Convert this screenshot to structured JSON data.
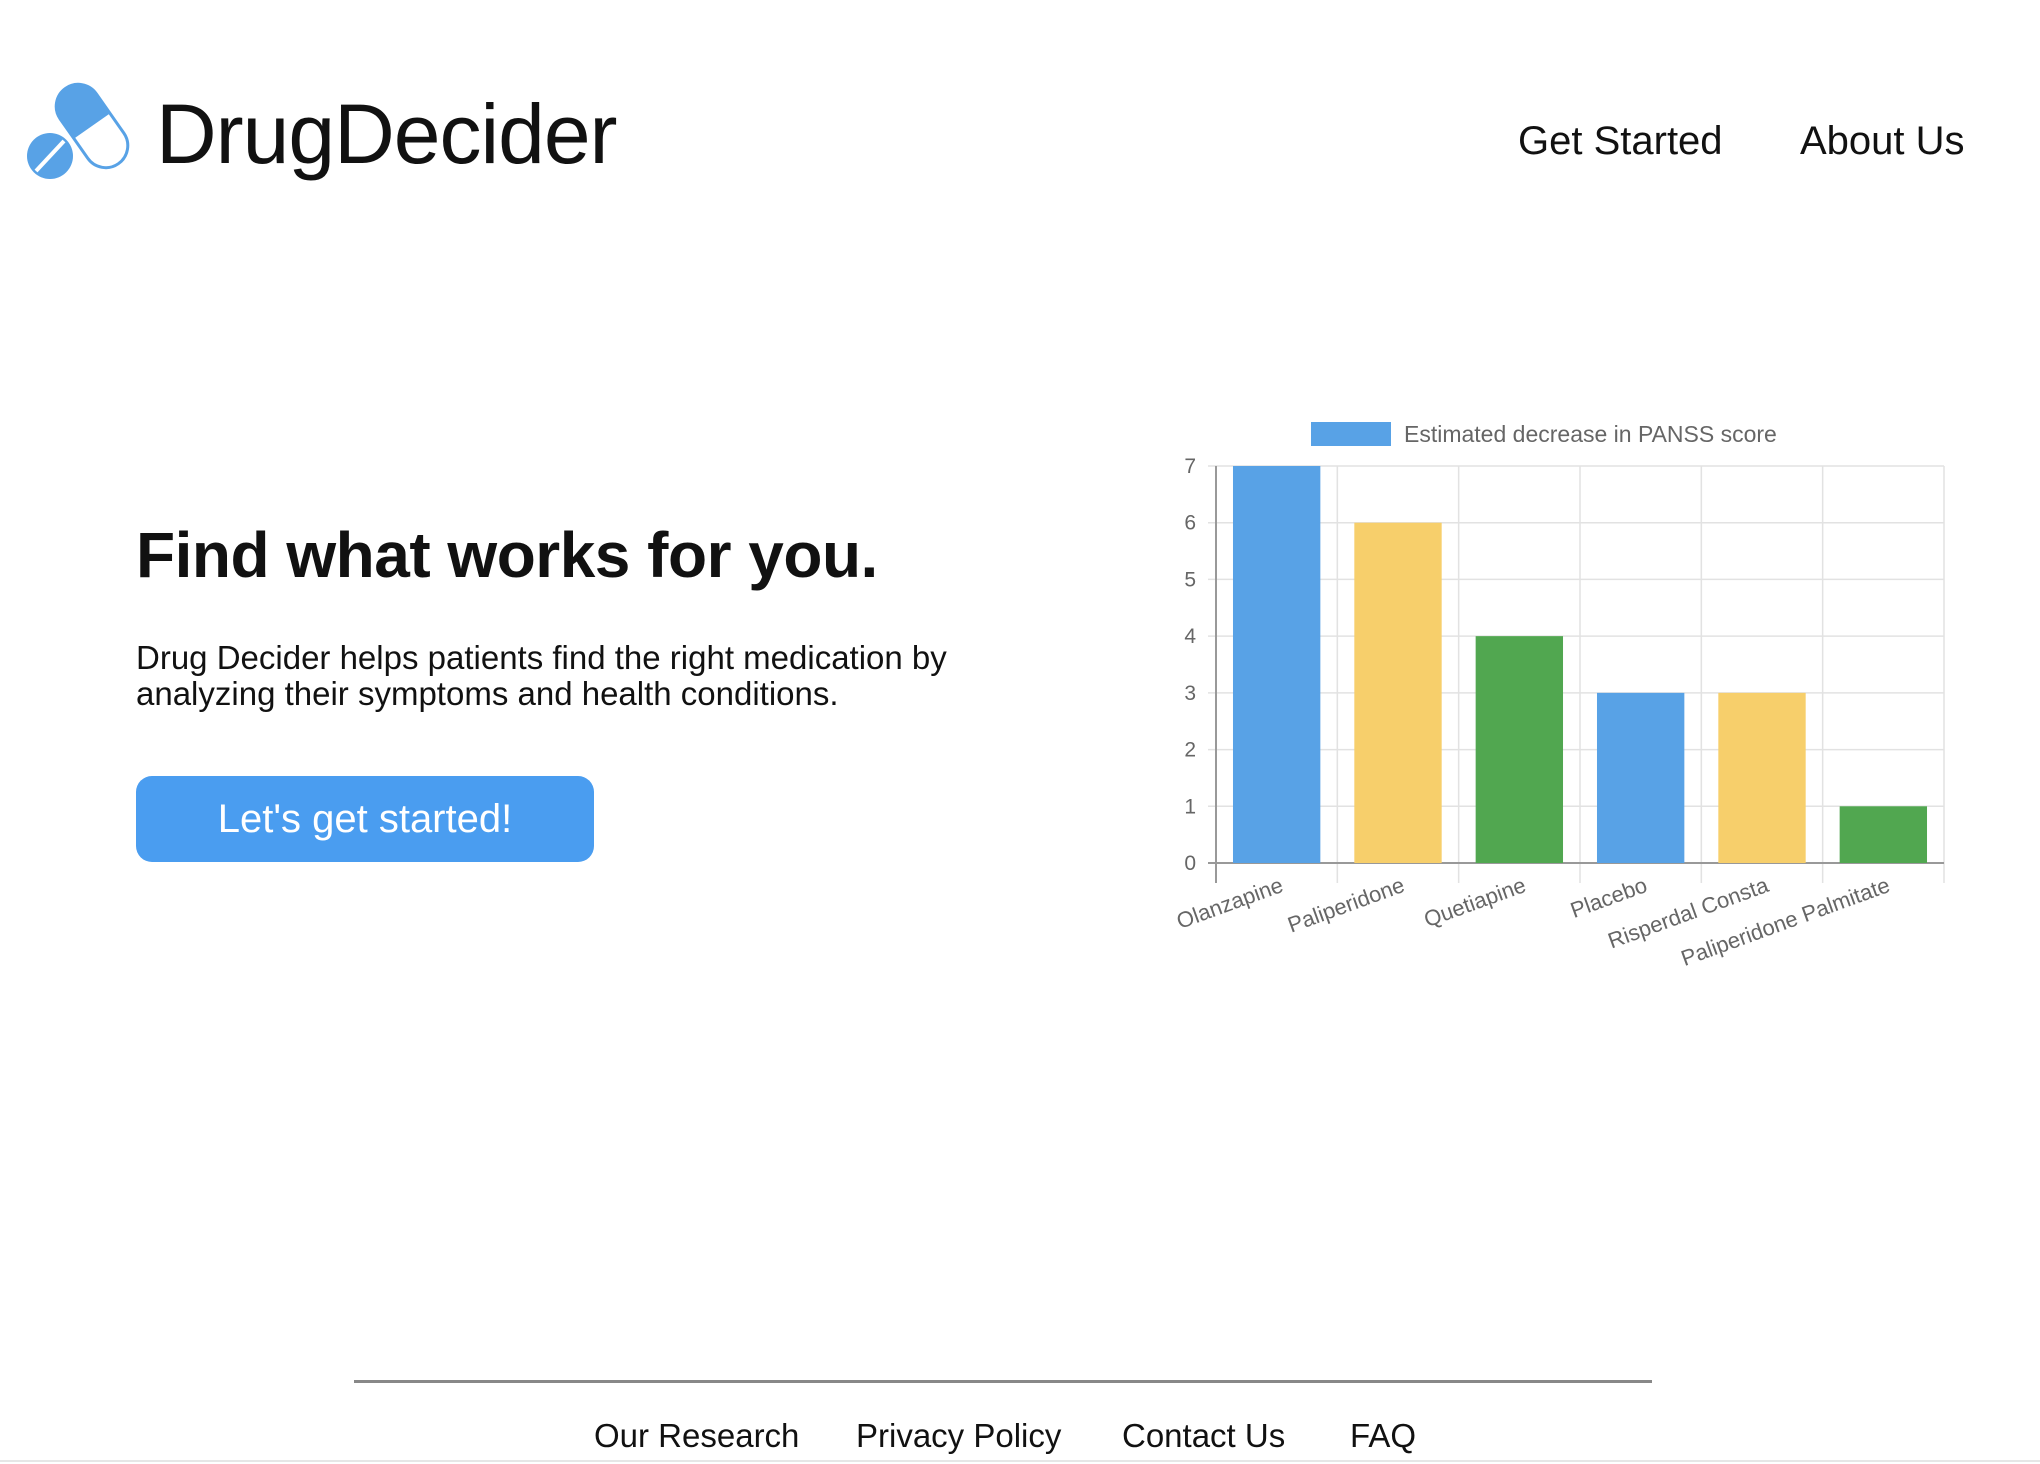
{
  "header": {
    "brand": "DrugDecider",
    "nav": [
      {
        "label": "Get Started"
      },
      {
        "label": "About Us"
      }
    ]
  },
  "hero": {
    "title": "Find what works for you.",
    "description": "Drug Decider helps patients find the right medication by analyzing their symptoms and health conditions.",
    "cta_label": "Let's get started!"
  },
  "colors": {
    "accent": "#4a9df0",
    "bar_blue": "#58a2e6",
    "bar_yellow": "#f7cf6b",
    "bar_green": "#51a750",
    "grid": "#e2e2e2",
    "axis_text": "#666666"
  },
  "chart_data": {
    "type": "bar",
    "categories": [
      "Olanzapine",
      "Paliperidone",
      "Quetiapine",
      "Placebo",
      "Risperdal Consta",
      "Paliperidone Palmitate"
    ],
    "series": [
      {
        "name": "Estimated decrease in PANSS score",
        "values": [
          7,
          6,
          4,
          3,
          3,
          1
        ]
      }
    ],
    "bar_colors": [
      "#58a2e6",
      "#f7cf6b",
      "#51a750",
      "#58a2e6",
      "#f7cf6b",
      "#51a750"
    ],
    "ylim": [
      0,
      7
    ],
    "yticks": [
      0,
      1,
      2,
      3,
      4,
      5,
      6,
      7
    ],
    "grid": true,
    "legend": "top"
  },
  "footer": {
    "links": [
      {
        "label": "Our Research"
      },
      {
        "label": "Privacy Policy"
      },
      {
        "label": "Contact Us"
      },
      {
        "label": "FAQ"
      }
    ]
  }
}
